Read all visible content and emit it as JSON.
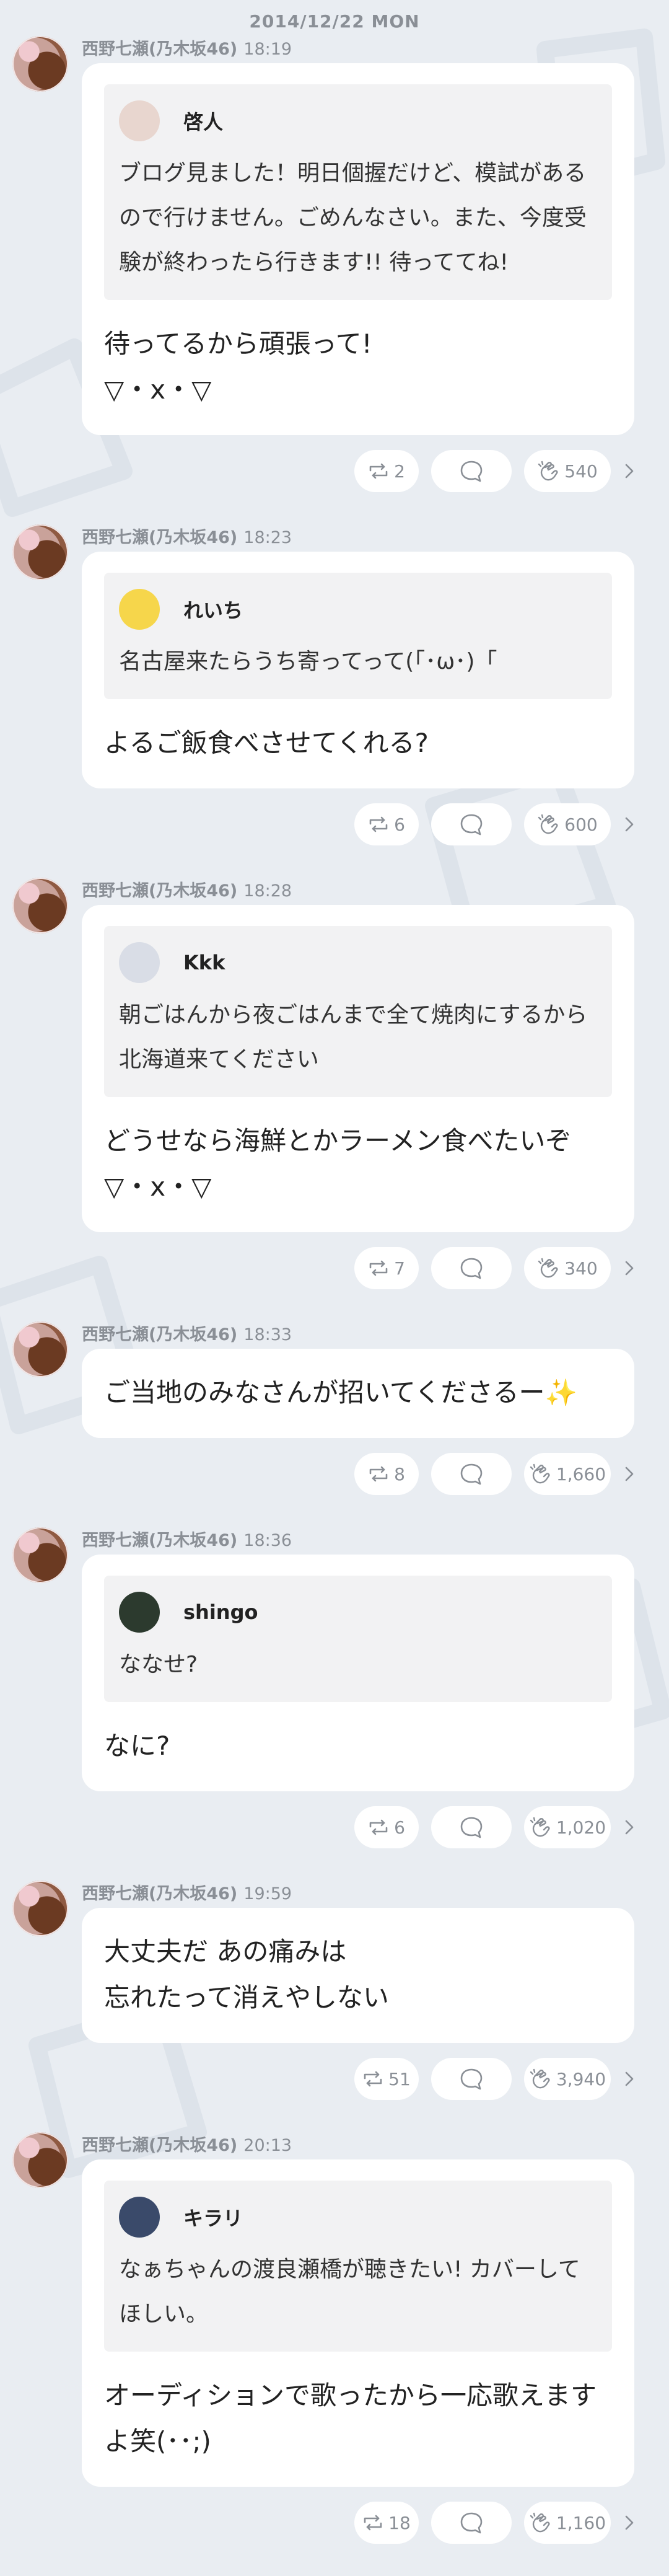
{
  "date_header": "2014/12/22 MON",
  "posts": [
    {
      "author": "西野七瀬(乃木坂46)",
      "time": "18:19",
      "quote": {
        "user": "啓人",
        "text": "ブログ見ました！明日個握だけど、模試があるので行けません。ごめんなさい。また、今度受験が終わったら行きます!! 待っててね!",
        "avatar_color": "#e8d6cf"
      },
      "text": "待ってるから頑張って!\n▽・x・▽",
      "retweets": "2",
      "claps": "540"
    },
    {
      "author": "西野七瀬(乃木坂46)",
      "time": "18:23",
      "quote": {
        "user": "れいち",
        "text": "名古屋来たらうち寄ってって(「･ω･)「",
        "avatar_color": "#f6d64b"
      },
      "text": "よるご飯食べさせてくれる?",
      "retweets": "6",
      "claps": "600"
    },
    {
      "author": "西野七瀬(乃木坂46)",
      "time": "18:28",
      "quote": {
        "user": "Kkk",
        "text": "朝ごはんから夜ごはんまで全て焼肉にするから北海道来てください",
        "avatar_color": "#d9dde6"
      },
      "text": "どうせなら海鮮とかラーメン食べたいぞ\n▽・x・▽",
      "retweets": "7",
      "claps": "340"
    },
    {
      "author": "西野七瀬(乃木坂46)",
      "time": "18:33",
      "quote": null,
      "text": "ご当地のみなさんが招いてくださるー✨",
      "retweets": "8",
      "claps": "1,660"
    },
    {
      "author": "西野七瀬(乃木坂46)",
      "time": "18:36",
      "quote": {
        "user": "shingo",
        "text": "ななせ?",
        "avatar_color": "#2c3a2e"
      },
      "text": "なに?",
      "retweets": "6",
      "claps": "1,020"
    },
    {
      "author": "西野七瀬(乃木坂46)",
      "time": "19:59",
      "quote": null,
      "text": "大丈夫だ あの痛みは\n忘れたって消えやしない",
      "retweets": "51",
      "claps": "3,940"
    },
    {
      "author": "西野七瀬(乃木坂46)",
      "time": "20:13",
      "quote": {
        "user": "キラリ",
        "text": "なぁちゃんの渡良瀬橋が聴きたい! カバーしてほしい。",
        "avatar_color": "#3a4a6a"
      },
      "text": "オーディションで歌ったから一応歌えますよ笑(･･;)",
      "retweets": "18",
      "claps": "1,160"
    }
  ],
  "colors": {
    "background": "#e9edf2",
    "card": "#ffffff",
    "quote_bg": "#f2f2f3",
    "meta": "#8a8f96"
  },
  "icons": {
    "retweet": "retweet-icon",
    "comment": "comment-icon",
    "clap": "clap-icon",
    "chevron": "chevron-right-icon"
  }
}
